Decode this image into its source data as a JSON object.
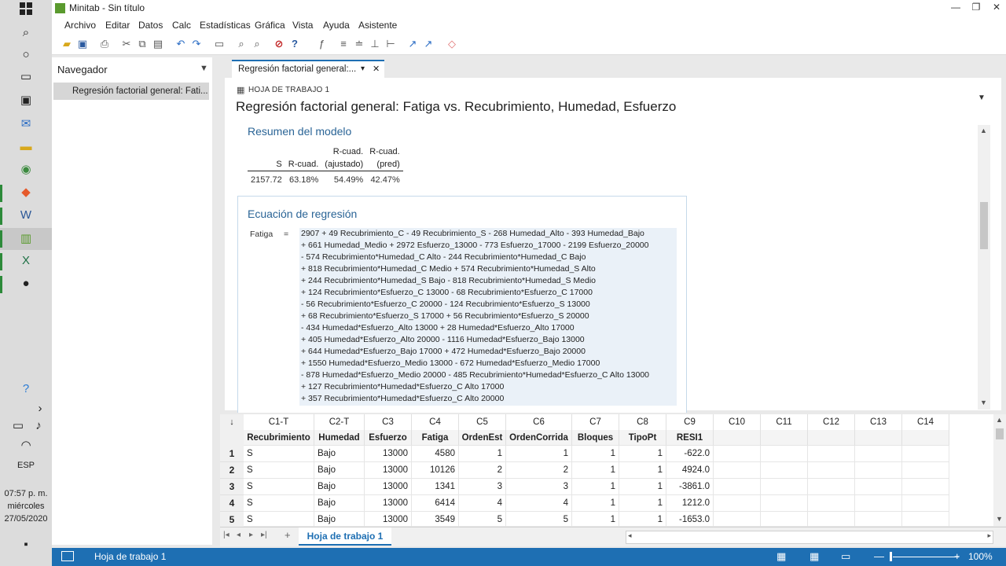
{
  "app": {
    "title": "Minitab - Sin título",
    "menu": [
      "Archivo",
      "Editar",
      "Datos",
      "Calc",
      "Estadísticas",
      "Gráfica",
      "Vista",
      "Ayuda",
      "Asistente"
    ]
  },
  "taskbar": {
    "lang": "ESP",
    "time": "07:57 p. m.",
    "day": "miércoles",
    "date": "27/05/2020"
  },
  "navigator": {
    "title": "Navegador",
    "items": [
      "Regresión factorial general: Fati..."
    ]
  },
  "document": {
    "tab_label": "Regresión factorial general:...",
    "worksheet_label": "HOJA DE TRABAJO 1",
    "title": "Regresión factorial general: Fatiga vs. Recubrimiento, Humedad, Esfuerzo",
    "model_summary": {
      "title": "Resumen del modelo",
      "headers": [
        [
          "",
          "S"
        ],
        [
          "",
          "R-cuad."
        ],
        [
          "R-cuad.",
          "(ajustado)"
        ],
        [
          "R-cuad.",
          "(pred)"
        ]
      ],
      "values": [
        "2157.72",
        "63.18%",
        "54.49%",
        "42.47%"
      ]
    },
    "regression": {
      "title": "Ecuación de regresión",
      "lhs": "Fatiga",
      "eq": "=",
      "lines": [
        "2907 + 49 Recubrimiento_C - 49 Recubrimiento_S - 268 Humedad_Alto - 393 Humedad_Bajo",
        "+ 661 Humedad_Medio + 2972 Esfuerzo_13000 - 773 Esfuerzo_17000 - 2199 Esfuerzo_20000",
        "- 574 Recubrimiento*Humedad_C Alto - 244 Recubrimiento*Humedad_C Bajo",
        "+ 818 Recubrimiento*Humedad_C Medio + 574 Recubrimiento*Humedad_S Alto",
        "+ 244 Recubrimiento*Humedad_S Bajo - 818 Recubrimiento*Humedad_S Medio",
        "+ 124 Recubrimiento*Esfuerzo_C 13000 - 68 Recubrimiento*Esfuerzo_C 17000",
        "- 56 Recubrimiento*Esfuerzo_C 20000 - 124 Recubrimiento*Esfuerzo_S 13000",
        "+ 68 Recubrimiento*Esfuerzo_S 17000 + 56 Recubrimiento*Esfuerzo_S 20000",
        "- 434 Humedad*Esfuerzo_Alto 13000 + 28 Humedad*Esfuerzo_Alto 17000",
        "+ 405 Humedad*Esfuerzo_Alto 20000 - 1116 Humedad*Esfuerzo_Bajo 13000",
        "+ 644 Humedad*Esfuerzo_Bajo 17000 + 472 Humedad*Esfuerzo_Bajo 20000",
        "+ 1550 Humedad*Esfuerzo_Medio 13000 - 672 Humedad*Esfuerzo_Medio 17000",
        "- 878 Humedad*Esfuerzo_Medio 20000 - 485 Recubrimiento*Humedad*Esfuerzo_C Alto 13000",
        "+ 127 Recubrimiento*Humedad*Esfuerzo_C Alto 17000",
        "+ 357 Recubrimiento*Humedad*Esfuerzo_C Alto 20000"
      ]
    }
  },
  "worksheet": {
    "corner": "↓",
    "columns": [
      {
        "id": "C1-T",
        "name": "Recubrimiento"
      },
      {
        "id": "C2-T",
        "name": "Humedad"
      },
      {
        "id": "C3",
        "name": "Esfuerzo"
      },
      {
        "id": "C4",
        "name": "Fatiga"
      },
      {
        "id": "C5",
        "name": "OrdenEst"
      },
      {
        "id": "C6",
        "name": "OrdenCorrida"
      },
      {
        "id": "C7",
        "name": "Bloques"
      },
      {
        "id": "C8",
        "name": "TipoPt"
      },
      {
        "id": "C9",
        "name": "RESI1"
      },
      {
        "id": "C10",
        "name": ""
      },
      {
        "id": "C11",
        "name": ""
      },
      {
        "id": "C12",
        "name": ""
      },
      {
        "id": "C13",
        "name": ""
      },
      {
        "id": "C14",
        "name": ""
      },
      {
        "id": "C15",
        "name": ""
      }
    ],
    "rows": [
      {
        "n": "1",
        "cells": [
          "S",
          "Bajo",
          "13000",
          "4580",
          "1",
          "1",
          "1",
          "1",
          "-622.0"
        ]
      },
      {
        "n": "2",
        "cells": [
          "S",
          "Bajo",
          "13000",
          "10126",
          "2",
          "2",
          "1",
          "1",
          "4924.0"
        ]
      },
      {
        "n": "3",
        "cells": [
          "S",
          "Bajo",
          "13000",
          "1341",
          "3",
          "3",
          "1",
          "1",
          "-3861.0"
        ]
      },
      {
        "n": "4",
        "cells": [
          "S",
          "Bajo",
          "13000",
          "6414",
          "4",
          "4",
          "1",
          "1",
          "1212.0"
        ]
      },
      {
        "n": "5",
        "cells": [
          "S",
          "Bajo",
          "13000",
          "3549",
          "5",
          "5",
          "1",
          "1",
          "-1653.0"
        ]
      }
    ],
    "sheet_tab": "Hoja de trabajo 1"
  },
  "statusbar": {
    "text": "Hoja de trabajo 1",
    "zoom": "100%"
  }
}
